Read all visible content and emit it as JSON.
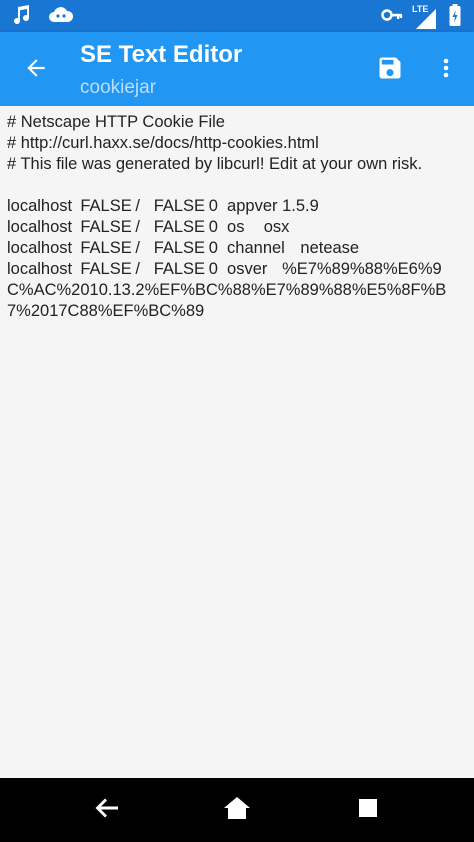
{
  "status_bar": {
    "network_label": "LTE",
    "icons": [
      "music-note-icon",
      "cloud-icon",
      "key-icon",
      "signal-icon",
      "battery-icon"
    ]
  },
  "app_bar": {
    "title": "SE Text Editor",
    "subtitle": "cookiejar",
    "icons": [
      "arrow-back-icon",
      "save-icon",
      "more-vert-icon"
    ]
  },
  "editor": {
    "content": "# Netscape HTTP Cookie File\n# http://curl.haxx.se/docs/http-cookies.html\n# This file was generated by libcurl! Edit at your own risk.\n\nlocalhost\tFALSE\t/\tFALSE\t0\tappver\t1.5.9\nlocalhost\tFALSE\t/\tFALSE\t0\tos\tosx\nlocalhost\tFALSE\t/\tFALSE\t0\tchannel\tnetease\nlocalhost\tFALSE\t/\tFALSE\t0\tosver\t%E7%89%88%E6%9C%AC%2010.13.2%EF%BC%88%E7%89%88%E5%8F%B7%2017C88%EF%BC%89"
  },
  "nav_bar": {
    "icons": [
      "nav-back-icon",
      "home-icon",
      "recents-icon"
    ]
  },
  "colors": {
    "status_bar": "#1976d2",
    "app_bar": "#2196f3",
    "subtitle": "#bbdefb",
    "editor_background": "#f5f5f5",
    "text": "#222222",
    "nav_bar": "#000000"
  }
}
